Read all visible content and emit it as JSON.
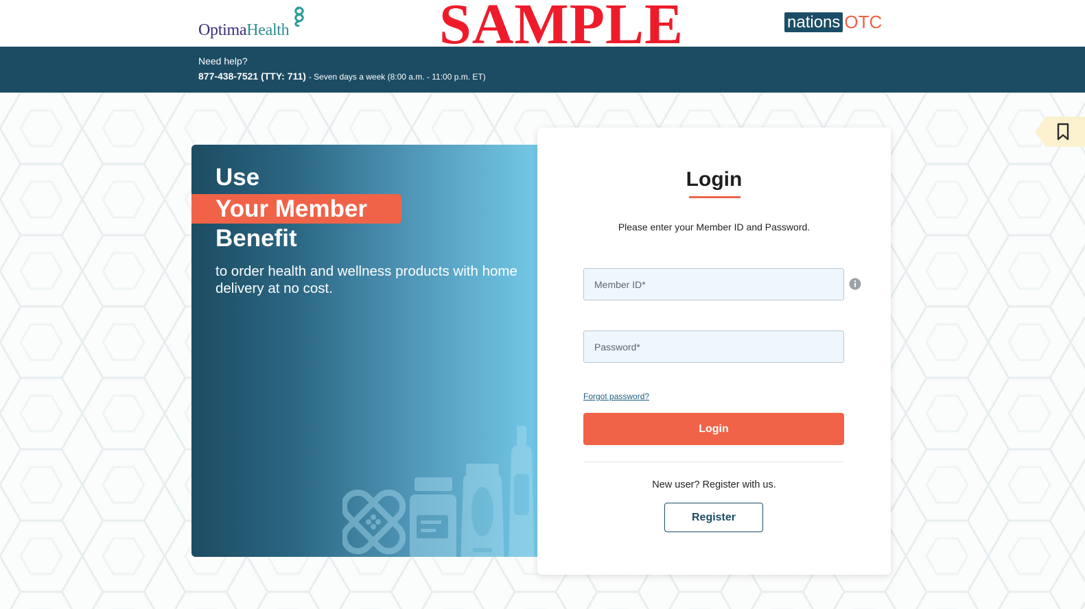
{
  "header": {
    "optima_logo": {
      "part1": "Optima",
      "part2": "Health"
    },
    "watermark": "SAMPLE",
    "nations_logo": {
      "part1": "nations",
      "part2": "OTC"
    }
  },
  "help": {
    "title": "Need help?",
    "phone": "877-438-7521 (TTY: 711)",
    "hours": "- Seven days a week (8:00 a.m. - 11:00 p.m. ET)"
  },
  "hero": {
    "line1": "Use",
    "line2": "Your Member",
    "line3": "Benefit",
    "subtitle": "to order health and wellness products with home delivery at no cost."
  },
  "login": {
    "title": "Login",
    "instructions": "Please enter your Member ID and Password.",
    "member_id_placeholder": "Member ID*",
    "password_placeholder": "Password*",
    "forgot_label": "Forgot password?",
    "login_button": "Login",
    "new_user_text": "New user? Register with us.",
    "register_button": "Register"
  },
  "icons": {
    "member_info": "info-icon",
    "bookmark": "bookmark-icon",
    "optima_mark": "optima-caduceus-icon",
    "products": "health-products-icon"
  },
  "colors": {
    "navy": "#1c4c63",
    "coral": "#f06349",
    "sample_red": "#ee1c2b"
  }
}
